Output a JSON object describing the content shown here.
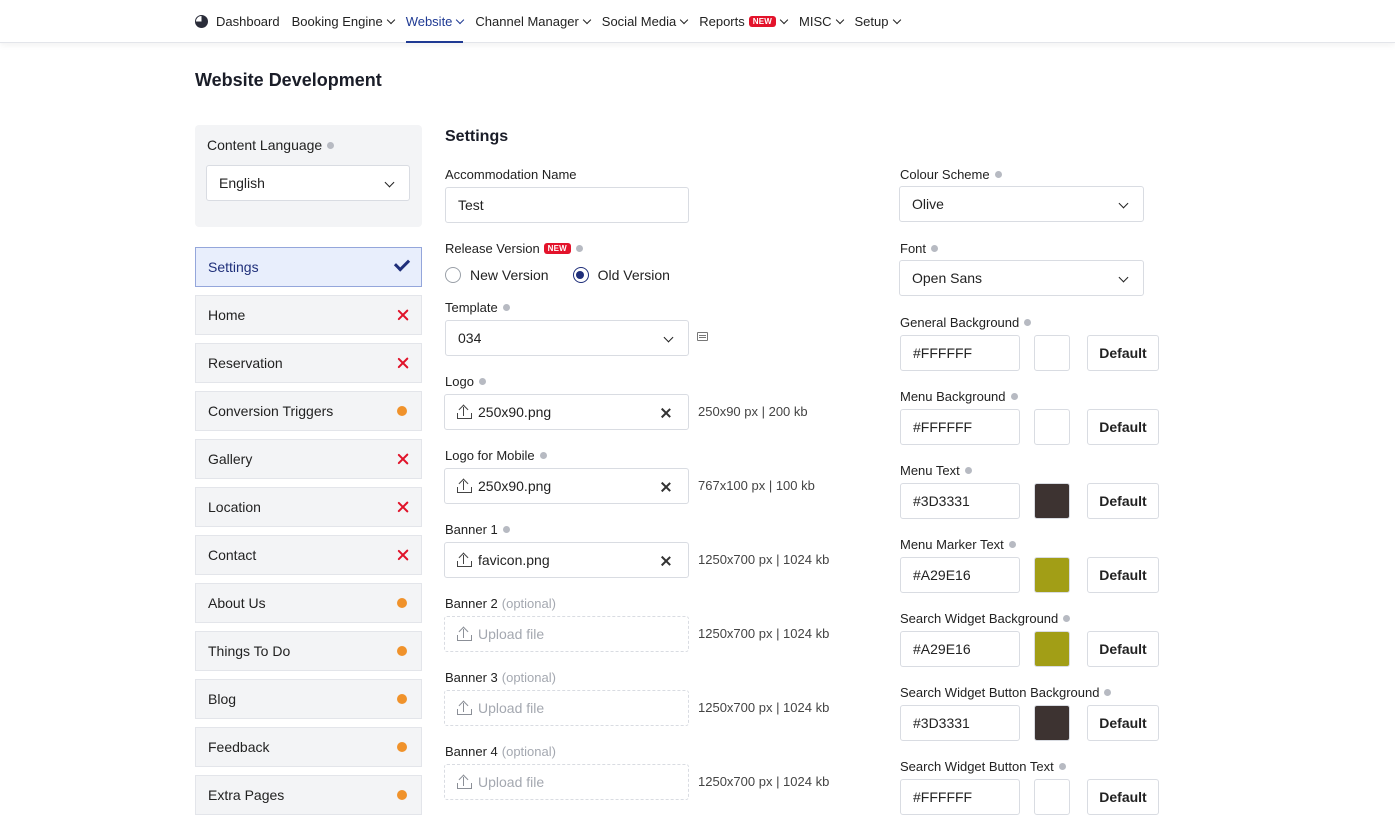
{
  "nav": {
    "items": [
      {
        "label": "Dashboard"
      },
      {
        "label": "Booking Engine"
      },
      {
        "label": "Website"
      },
      {
        "label": "Channel Manager"
      },
      {
        "label": "Social Media"
      },
      {
        "label": "Reports",
        "badge": "NEW"
      },
      {
        "label": "MISC"
      },
      {
        "label": "Setup"
      }
    ]
  },
  "page": {
    "title": "Website Development"
  },
  "language": {
    "label": "Content Language",
    "value": "English"
  },
  "sidebar": {
    "items": [
      {
        "label": "Settings",
        "status": "done"
      },
      {
        "label": "Home",
        "status": "error"
      },
      {
        "label": "Reservation",
        "status": "error"
      },
      {
        "label": "Conversion Triggers",
        "status": "pending"
      },
      {
        "label": "Gallery",
        "status": "error"
      },
      {
        "label": "Location",
        "status": "error"
      },
      {
        "label": "Contact",
        "status": "error"
      },
      {
        "label": "About Us",
        "status": "pending"
      },
      {
        "label": "Things To Do",
        "status": "pending"
      },
      {
        "label": "Blog",
        "status": "pending"
      },
      {
        "label": "Feedback",
        "status": "pending"
      },
      {
        "label": "Extra Pages",
        "status": "pending"
      }
    ]
  },
  "settings": {
    "title": "Settings",
    "accommodation": {
      "label": "Accommodation Name",
      "value": "Test"
    },
    "release": {
      "label": "Release Version",
      "badge": "NEW",
      "option_new": "New Version",
      "option_old": "Old Version",
      "selected": "Old Version"
    },
    "template": {
      "label": "Template",
      "value": "034"
    },
    "logo": {
      "label": "Logo",
      "file": "250x90.png",
      "note": "250x90 px | 200 kb"
    },
    "logo_mobile": {
      "label": "Logo for Mobile",
      "file": "250x90.png",
      "note": "767x100 px | 100 kb"
    },
    "banner1": {
      "label": "Banner 1",
      "file": "favicon.png",
      "note": "1250x700 px | 1024 kb"
    },
    "banner2": {
      "label": "Banner 2",
      "optional": "(optional)",
      "placeholder": "Upload file",
      "note": "1250x700 px | 1024 kb"
    },
    "banner3": {
      "label": "Banner 3",
      "optional": "(optional)",
      "placeholder": "Upload file",
      "note": "1250x700 px | 1024 kb"
    },
    "banner4": {
      "label": "Banner 4",
      "optional": "(optional)",
      "placeholder": "Upload file",
      "note": "1250x700 px | 1024 kb"
    },
    "colour_scheme": {
      "label": "Colour Scheme",
      "value": "Olive"
    },
    "font": {
      "label": "Font",
      "value": "Open Sans"
    },
    "default_label": "Default",
    "colors": [
      {
        "label": "General Background",
        "value": "#FFFFFF",
        "swatch": "#FFFFFF"
      },
      {
        "label": "Menu Background",
        "value": "#FFFFFF",
        "swatch": "#FFFFFF"
      },
      {
        "label": "Menu Text",
        "value": "#3D3331",
        "swatch": "#3D3331"
      },
      {
        "label": "Menu Marker Text",
        "value": "#A29E16",
        "swatch": "#A29E16"
      },
      {
        "label": "Search Widget Background",
        "value": "#A29E16",
        "swatch": "#A29E16"
      },
      {
        "label": "Search Widget Button Background",
        "value": "#3D3331",
        "swatch": "#3D3331"
      },
      {
        "label": "Search Widget Button Text",
        "value": "#FFFFFF",
        "swatch": "#FFFFFF"
      }
    ]
  }
}
